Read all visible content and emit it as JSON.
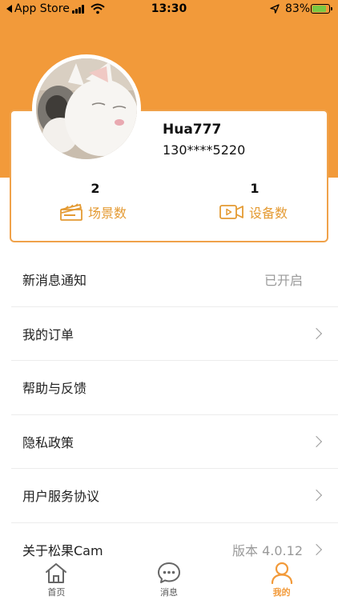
{
  "status_bar": {
    "back_label": "App Store",
    "time": "13:30",
    "battery": "83%",
    "battery_level": 0.83
  },
  "profile": {
    "username": "Hua777",
    "phone": "130****5220",
    "avatar_icon": "cat-avatar"
  },
  "stats": {
    "scenes": {
      "count": "2",
      "label": "场景数",
      "icon": "clapperboard-icon"
    },
    "devices": {
      "count": "1",
      "label": "设备数",
      "icon": "video-camera-icon"
    }
  },
  "menu": {
    "items": [
      {
        "label": "新消息通知",
        "value": "已开启",
        "chevron": false
      },
      {
        "label": "我的订单",
        "value": "",
        "chevron": true
      },
      {
        "label": "帮助与反馈",
        "value": "",
        "chevron": false
      },
      {
        "label": "隐私政策",
        "value": "",
        "chevron": true
      },
      {
        "label": "用户服务协议",
        "value": "",
        "chevron": true
      },
      {
        "label": "关于松果Cam",
        "value": "版本 4.0.12",
        "chevron": true
      }
    ]
  },
  "tab_bar": {
    "tabs": [
      {
        "label": "首页",
        "icon": "home-icon",
        "active": false
      },
      {
        "label": "消息",
        "icon": "message-icon",
        "active": false
      },
      {
        "label": "我的",
        "icon": "profile-icon",
        "active": true
      }
    ]
  },
  "colors": {
    "accent": "#f29a3a",
    "stat_label": "#e49a32",
    "muted_text": "#9a9a9a"
  }
}
